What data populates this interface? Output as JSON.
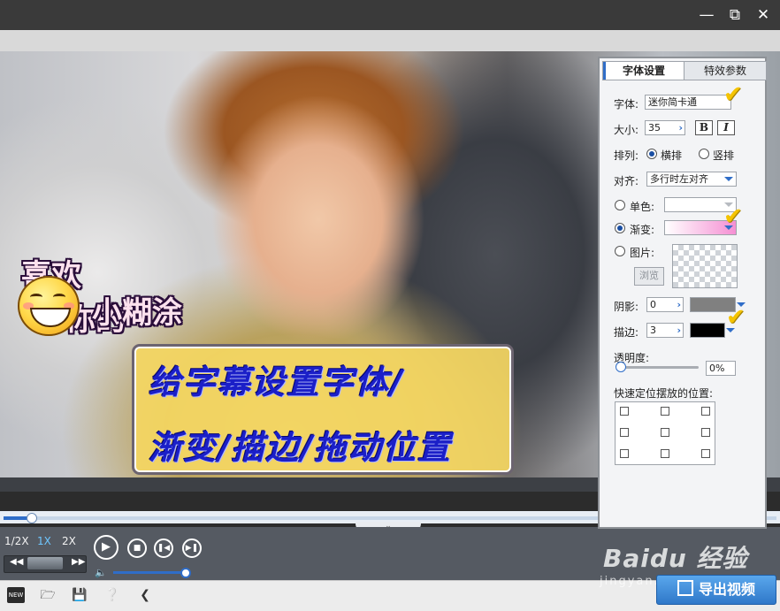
{
  "window": {
    "minimize_icon": "minimize-icon",
    "maximize_icon": "restore-icon",
    "close_icon": "close-icon"
  },
  "video": {
    "sticker_lines": [
      "喜欢",
      "你的",
      "小糊涂"
    ],
    "subtitle_lines": [
      "给字幕设置字体/",
      "渐变/描边/拖动位置"
    ]
  },
  "playback": {
    "speeds": [
      "1/2X",
      "1X",
      "2X"
    ],
    "active_speed": "1X",
    "seek_progress": 0.035,
    "volume": 1.0
  },
  "toolbar": {
    "icons": [
      "new-icon",
      "open-folder-icon",
      "save-icon",
      "help-icon",
      "share-icon"
    ],
    "new_label": "NEW"
  },
  "export": {
    "label": "导出视频"
  },
  "watermark": {
    "text": "Baidu 经验",
    "sub": "jingyan.baidu.com"
  },
  "panel": {
    "tabs": [
      "字体设置",
      "特效参数"
    ],
    "font_label": "字体:",
    "font_value": "迷你简卡通",
    "size_label": "大小:",
    "size_value": "35",
    "bold_label": "B",
    "italic_label": "I",
    "arrange_label": "排列:",
    "horizontal_label": "横排",
    "vertical_label": "竖排",
    "align_label": "对齐:",
    "align_value": "多行时左对齐",
    "solid_label": "单色:",
    "gradient_label": "渐变:",
    "image_label": "图片:",
    "browse_label": "浏览",
    "shadow_label": "阴影:",
    "shadow_value": "0",
    "stroke_label": "描边:",
    "stroke_value": "3",
    "opacity_label": "透明度:",
    "opacity_value": "0%",
    "quick_pos_label": "快速定位摆放的位置:",
    "colors": {
      "gradient": "#f58fd3",
      "shadow": "#808080",
      "stroke": "#000000",
      "accent": "#2f6dc8"
    }
  }
}
